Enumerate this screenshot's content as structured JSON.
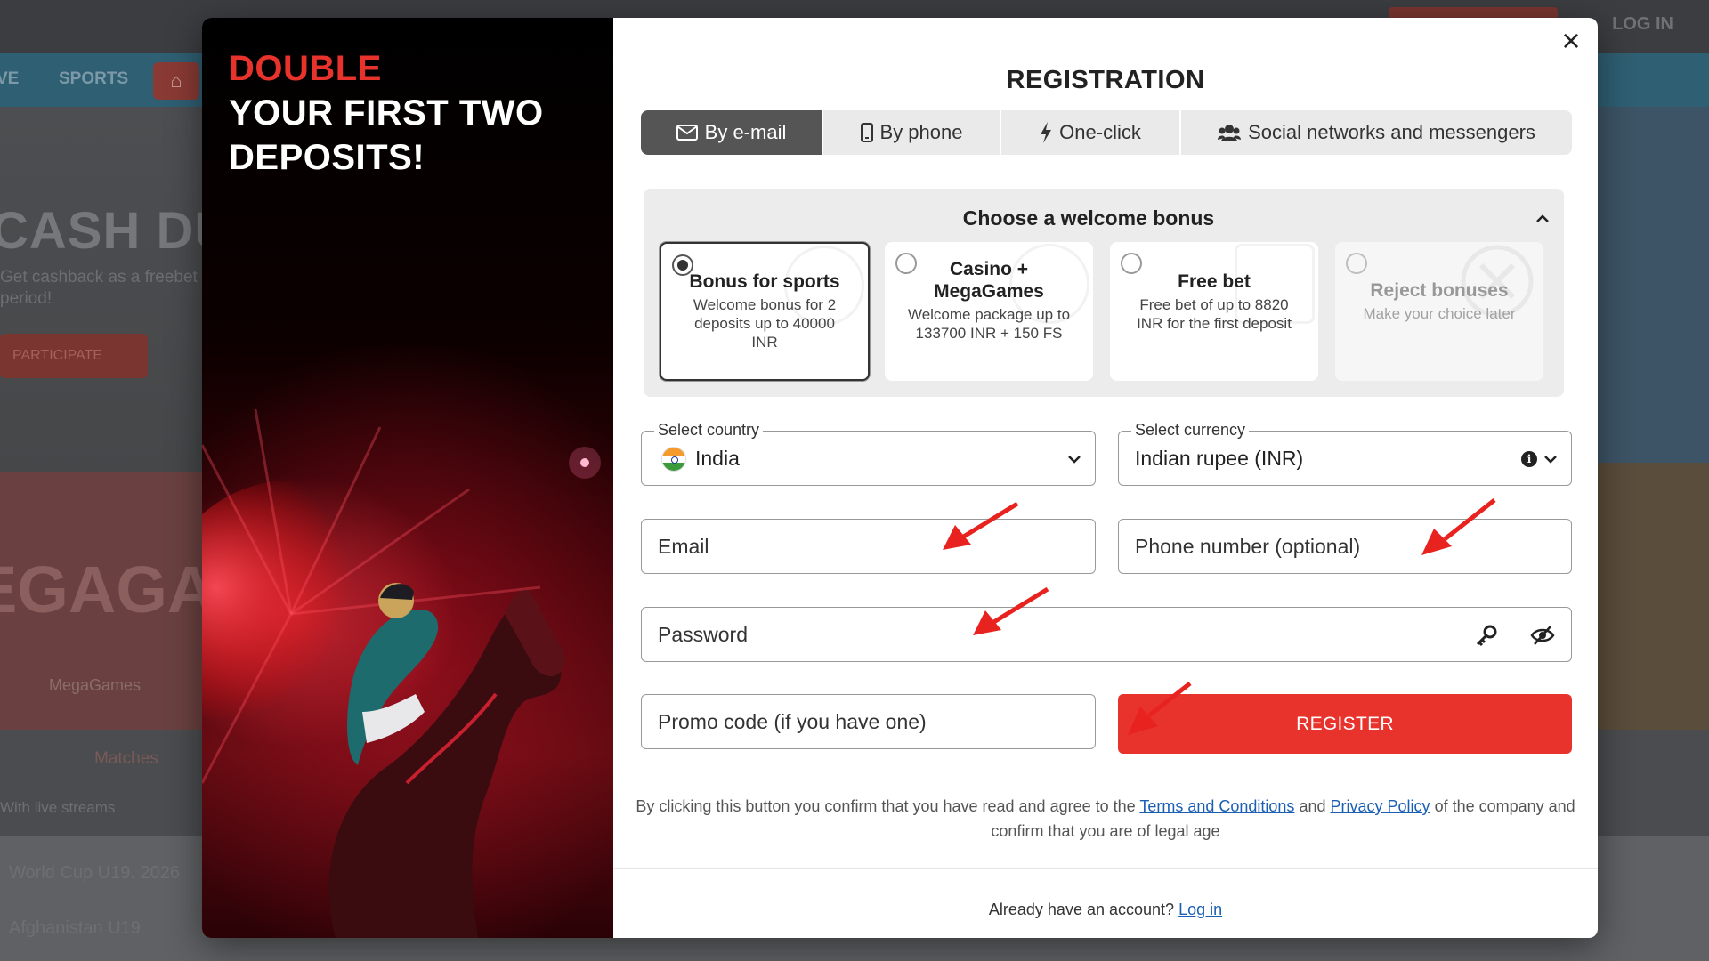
{
  "background": {
    "top_login": "LOG IN",
    "nav_items": [
      "VE",
      "SPORTS"
    ],
    "hero_title": "CASH DU",
    "hero_sub": "Get cashback as a freebet period!",
    "hero_button": "PARTICIPATE",
    "banner_text": "EGAGAM",
    "tab_matches": "Matches",
    "tab_megagames": "MegaGames",
    "streams": "With live streams",
    "row1": "World Cup U19. 2026",
    "row2": "Afghanistan U19"
  },
  "promo": {
    "accent": "DOUBLE",
    "rest": "YOUR FIRST TWO DEPOSITS!"
  },
  "modal": {
    "close": "×",
    "title": "REGISTRATION",
    "tabs": [
      {
        "label": "By e-mail",
        "icon": "envelope-icon",
        "active": true
      },
      {
        "label": "By phone",
        "icon": "phone-icon",
        "active": false
      },
      {
        "label": "One-click",
        "icon": "lightning-icon",
        "active": false
      },
      {
        "label": "Social networks and messengers",
        "icon": "people-icon",
        "active": false
      }
    ]
  },
  "bonus": {
    "heading": "Choose a welcome bonus",
    "options": [
      {
        "name": "Bonus for sports",
        "desc": "Welcome bonus for 2 deposits up to 40000 INR",
        "selected": true
      },
      {
        "name": "Casino + MegaGames",
        "desc": "Welcome package up to 133700 INR + 150 FS",
        "selected": false
      },
      {
        "name": "Free bet",
        "desc": "Free bet of up to 8820 INR for the first deposit",
        "selected": false
      },
      {
        "name": "Reject bonuses",
        "desc": "Make your choice later",
        "selected": false
      }
    ]
  },
  "form": {
    "country_label": "Select country",
    "country_value": "India",
    "currency_label": "Select currency",
    "currency_value": "Indian rupee (INR)",
    "email_placeholder": "Email",
    "phone_placeholder": "Phone number (optional)",
    "password_placeholder": "Password",
    "promo_placeholder": "Promo code (if you have one)",
    "register": "REGISTER"
  },
  "consent": {
    "before": "By clicking this button you confirm that you have read and agree to the",
    "terms": "Terms and Conditions",
    "and": "and",
    "privacy": "Privacy Policy",
    "after": "of the company and confirm that you are of legal age"
  },
  "footer": {
    "question": "Already have an account?",
    "login": "Log in"
  },
  "colors": {
    "accent_red": "#e8322c",
    "active_tab": "#555555",
    "link_blue": "#1a5fb4",
    "annotation_arrow": "#e8231f"
  }
}
